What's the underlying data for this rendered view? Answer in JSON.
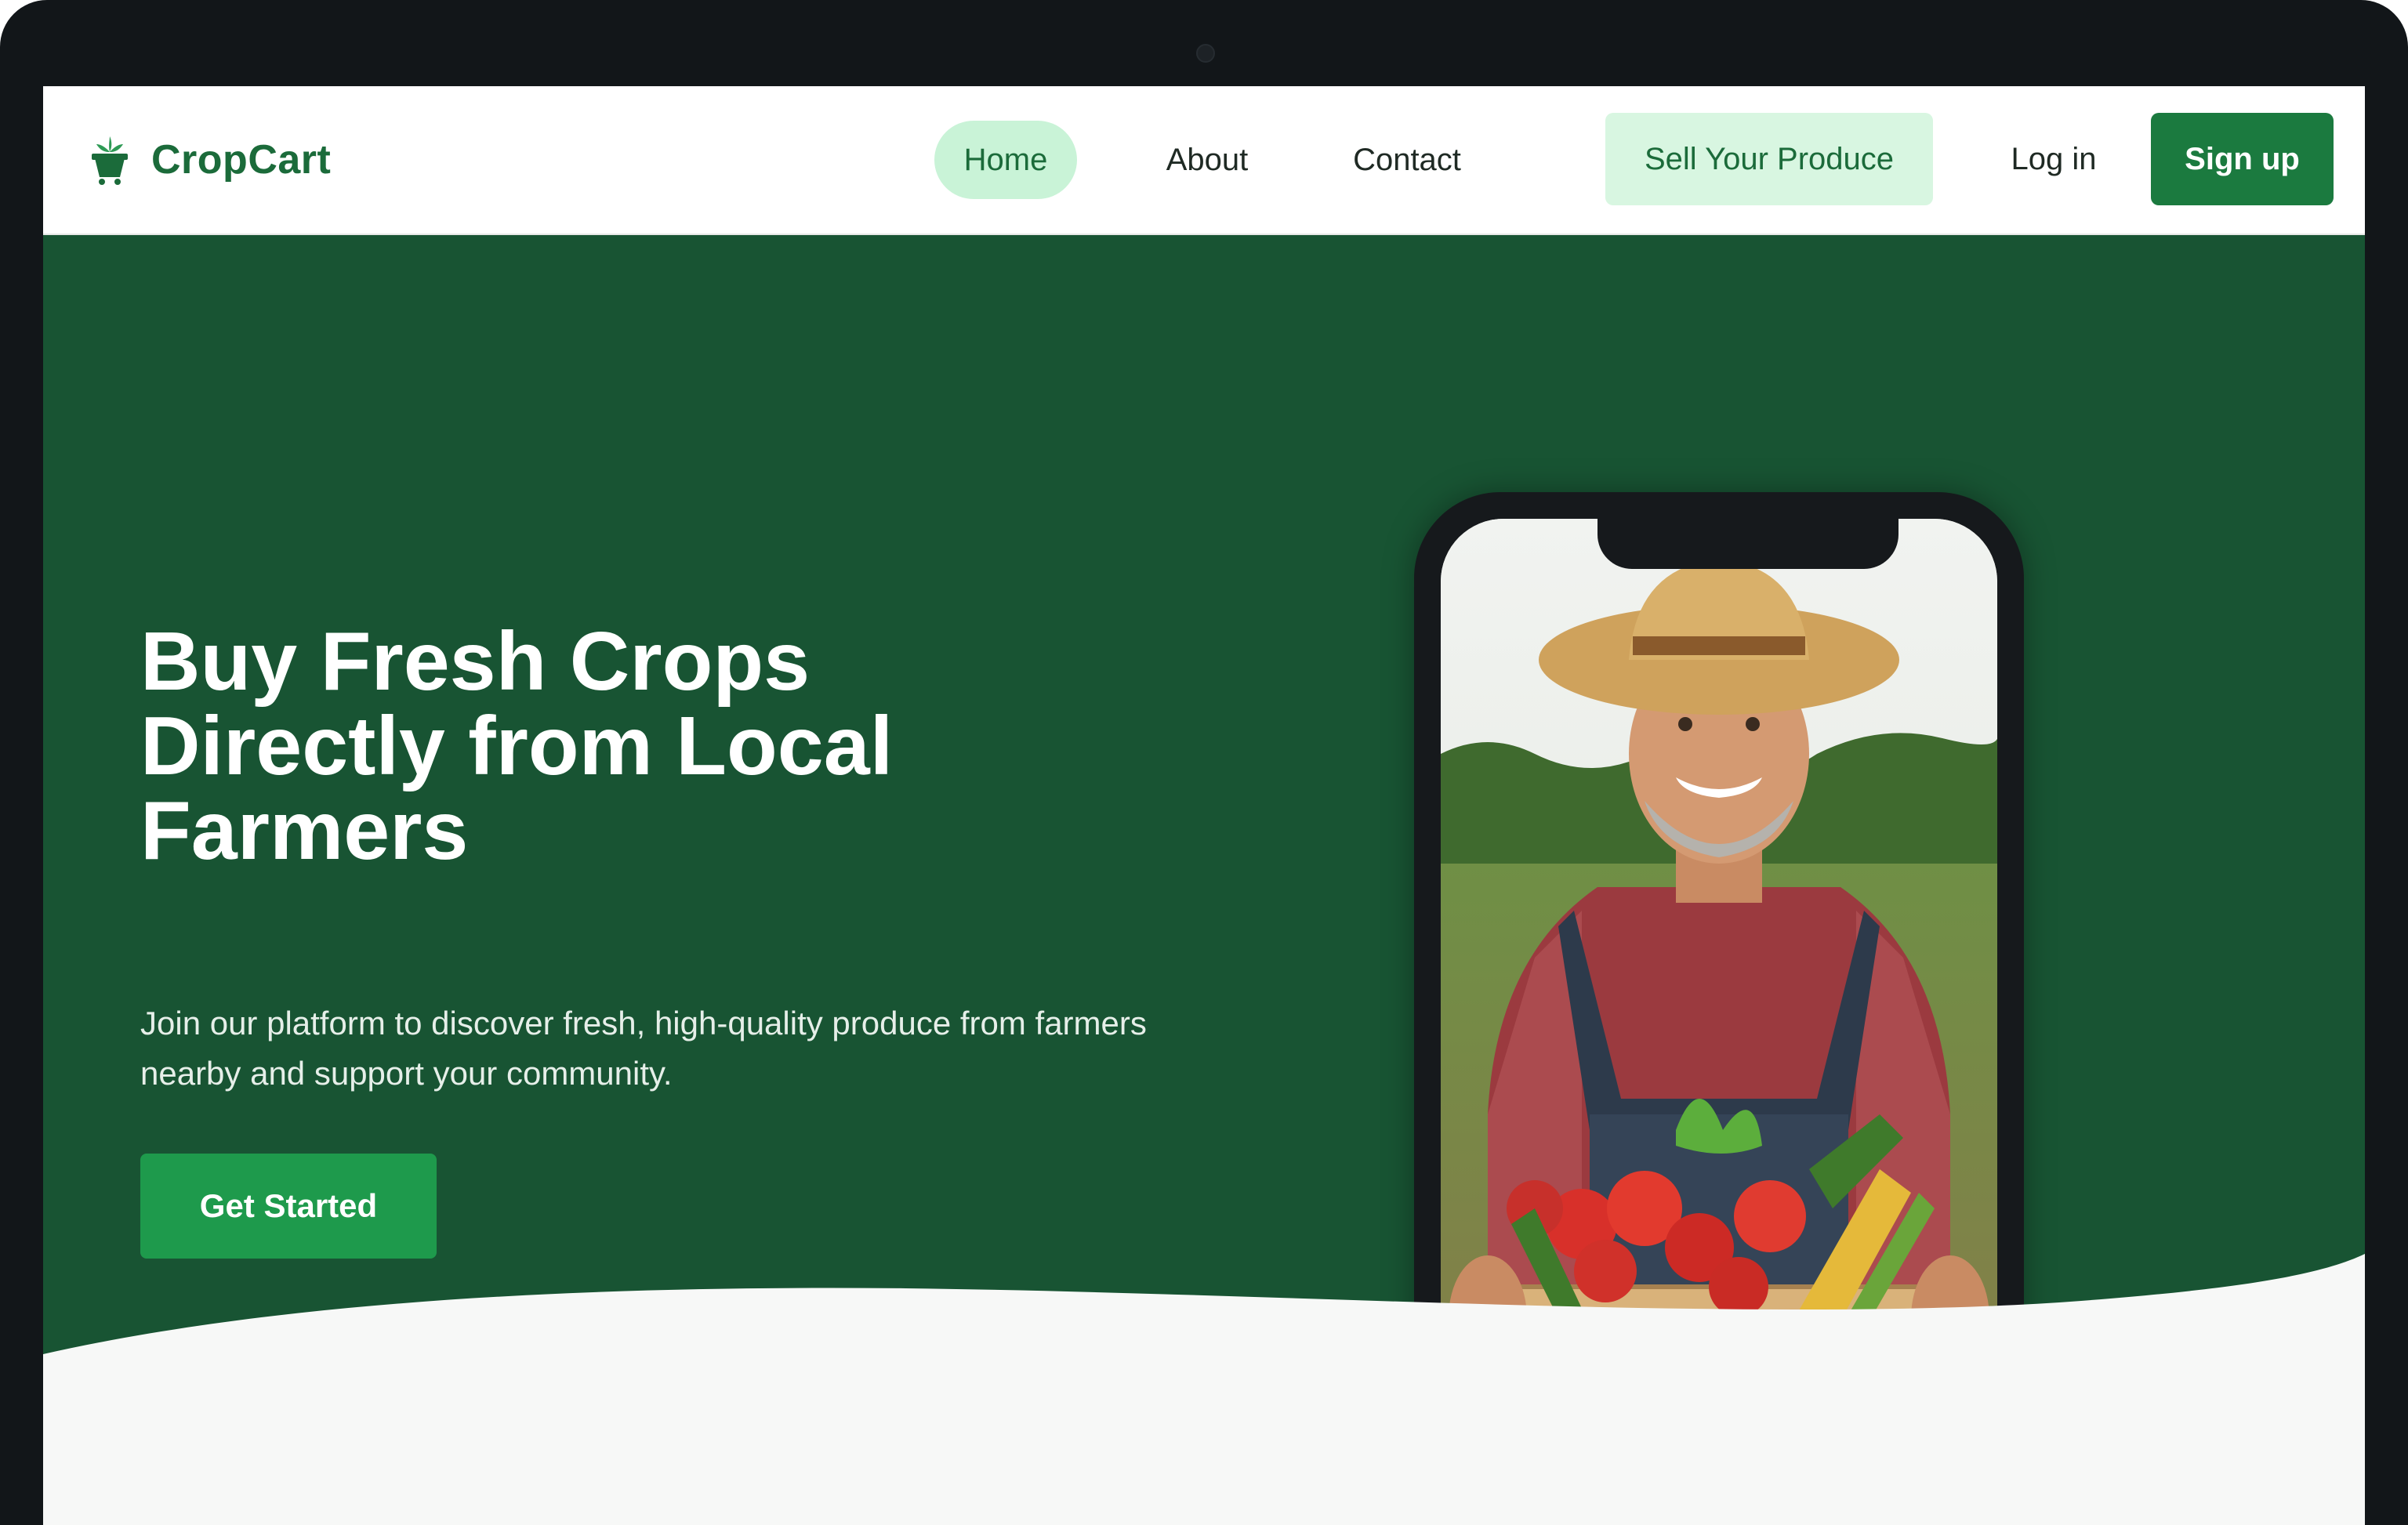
{
  "brand": {
    "name": "CropCart",
    "color": "#1b6b3a"
  },
  "nav": {
    "home": "Home",
    "about": "About",
    "contact": "Contact",
    "active": "Home"
  },
  "actions": {
    "sell": "Sell Your Produce",
    "login": "Log in",
    "signup": "Sign up"
  },
  "hero": {
    "headline": "Buy Fresh Crops Directly from Local Farmers",
    "subtext": "Join our platform to discover fresh, high-quality produce from farmers nearby and support your community.",
    "cta": "Get Started",
    "background": "#185433",
    "image": "farmer-with-vegetable-crate"
  },
  "icons": {
    "logo": "shopping-basket-icon"
  },
  "colors": {
    "accent": "#1e9a4c",
    "nav_active_bg": "#c9f3d7",
    "sell_bg": "#d8f6e1"
  }
}
